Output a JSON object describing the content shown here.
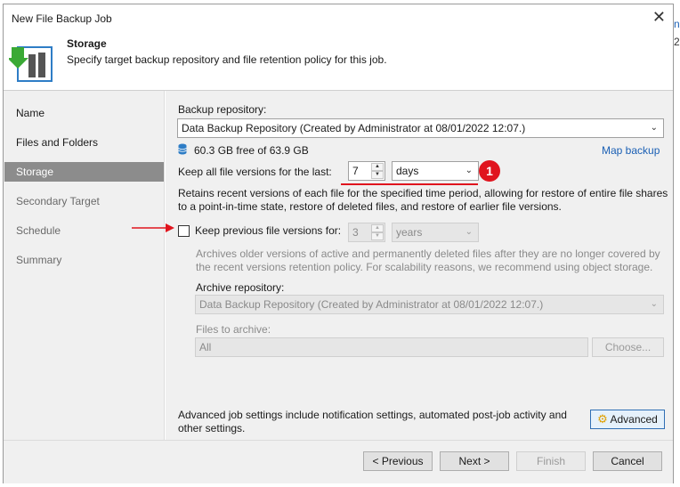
{
  "window": {
    "title": "New File Backup Job"
  },
  "header": {
    "title": "Storage",
    "subtitle": "Specify target backup repository and file retention policy for this job.",
    "icon": "storage-backup-icon"
  },
  "sidebar": {
    "items": [
      {
        "label": "Name",
        "state": "normal"
      },
      {
        "label": "Files and Folders",
        "state": "normal"
      },
      {
        "label": "Storage",
        "state": "active"
      },
      {
        "label": "Secondary Target",
        "state": "disabled"
      },
      {
        "label": "Schedule",
        "state": "disabled"
      },
      {
        "label": "Summary",
        "state": "disabled"
      }
    ]
  },
  "storage": {
    "repo_label": "Backup repository:",
    "repo_value": "Data Backup Repository (Created by Administrator at 08/01/2022 12:07.)",
    "free_space": "60.3 GB free of 63.9 GB",
    "map_backup": "Map backup",
    "keep_label": "Keep all file versions for the last:",
    "keep_value": "7",
    "keep_unit": "days",
    "keep_desc_1": "Retains recent versions of each file for the specified time period, allowing for restore of entire file shares",
    "keep_desc_2": "to a point-in-time state, restore of deleted files, and restore of earlier file versions.",
    "prev_label": "Keep previous file versions for:",
    "prev_checked": false,
    "prev_value": "3",
    "prev_unit": "years",
    "prev_desc_1": "Archives older versions of active and permanently deleted files after they are no longer covered by",
    "prev_desc_2": "the recent versions retention policy. For scalability reasons, we recommend using object storage.",
    "archive_label": "Archive repository:",
    "archive_value": "Data Backup Repository (Created by Administrator at 08/01/2022 12:07.)",
    "files_label": "Files to archive:",
    "files_value": "All",
    "choose_label": "Choose...",
    "advanced_desc_1": "Advanced job settings include notification settings, automated post-job activity and",
    "advanced_desc_2": "other settings.",
    "advanced_label": "Advanced"
  },
  "annotation": {
    "badge": "1"
  },
  "footer": {
    "previous": "< Previous",
    "next": "Next >",
    "finish": "Finish",
    "cancel": "Cancel"
  },
  "colors": {
    "accent": "#1a5fb4",
    "active_nav": "#8c8c8c",
    "annotation_red": "#e0141e"
  }
}
